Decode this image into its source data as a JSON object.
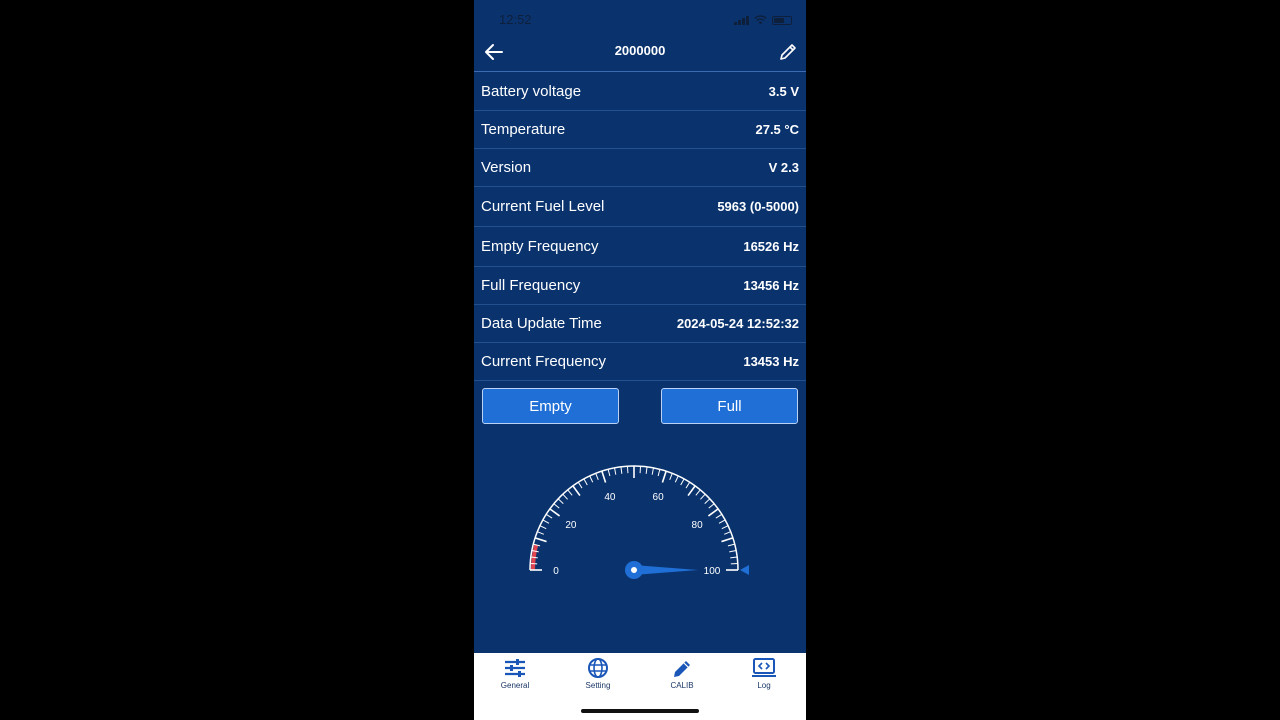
{
  "status_bar": {
    "time": "12:52"
  },
  "header": {
    "title": "2000000"
  },
  "info_rows": [
    {
      "label": "Battery voltage",
      "value": "3.5 V"
    },
    {
      "label": "Temperature",
      "value": "27.5 °C"
    },
    {
      "label": "Version",
      "value": "V 2.3"
    },
    {
      "label": "Current Fuel Level",
      "value": "5963 (0-5000)"
    },
    {
      "label": "Empty Frequency",
      "value": "16526  Hz"
    },
    {
      "label": "Full Frequency",
      "value": "13456  Hz"
    },
    {
      "label": "Data Update Time",
      "value": "2024-05-24 12:52:32"
    },
    {
      "label": "Current Frequency",
      "value": "13453  Hz"
    }
  ],
  "buttons": {
    "empty": "Empty",
    "full": "Full"
  },
  "gauge": {
    "labels": [
      "0",
      "20",
      "40",
      "60",
      "80",
      "100"
    ],
    "min": 0,
    "max": 100,
    "value": 100,
    "accent_color": "#1f6fd6",
    "low_color": "#e0454f"
  },
  "tabs": [
    {
      "label": "General",
      "icon": "sliders-icon"
    },
    {
      "label": "Setting",
      "icon": "globe-icon"
    },
    {
      "label": "CALIB",
      "icon": "pencil-icon"
    },
    {
      "label": "Log",
      "icon": "code-monitor-icon"
    }
  ],
  "colors": {
    "background": "#0a336e",
    "accent": "#1f6fd6"
  }
}
